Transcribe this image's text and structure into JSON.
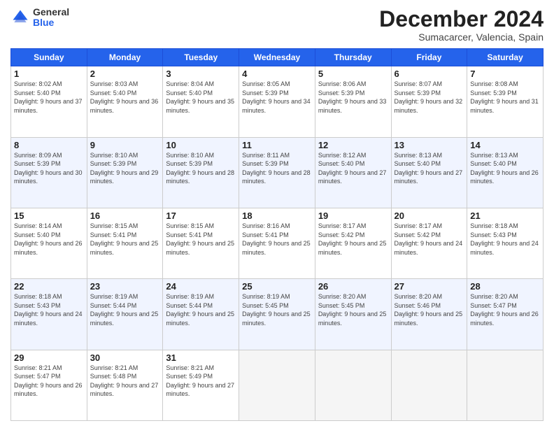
{
  "header": {
    "logo_general": "General",
    "logo_blue": "Blue",
    "month_title": "December 2024",
    "location": "Sumacarcer, Valencia, Spain"
  },
  "calendar": {
    "days_of_week": [
      "Sunday",
      "Monday",
      "Tuesday",
      "Wednesday",
      "Thursday",
      "Friday",
      "Saturday"
    ],
    "weeks": [
      [
        {
          "day": "",
          "info": ""
        },
        {
          "day": "",
          "info": ""
        },
        {
          "day": "",
          "info": ""
        },
        {
          "day": "",
          "info": ""
        },
        {
          "day": "",
          "info": ""
        },
        {
          "day": "",
          "info": ""
        },
        {
          "day": "",
          "info": ""
        }
      ]
    ],
    "cells": [
      {
        "day": "1",
        "sunrise": "8:02 AM",
        "sunset": "5:40 PM",
        "daylight": "9 hours and 37 minutes."
      },
      {
        "day": "2",
        "sunrise": "8:03 AM",
        "sunset": "5:40 PM",
        "daylight": "9 hours and 36 minutes."
      },
      {
        "day": "3",
        "sunrise": "8:04 AM",
        "sunset": "5:40 PM",
        "daylight": "9 hours and 35 minutes."
      },
      {
        "day": "4",
        "sunrise": "8:05 AM",
        "sunset": "5:39 PM",
        "daylight": "9 hours and 34 minutes."
      },
      {
        "day": "5",
        "sunrise": "8:06 AM",
        "sunset": "5:39 PM",
        "daylight": "9 hours and 33 minutes."
      },
      {
        "day": "6",
        "sunrise": "8:07 AM",
        "sunset": "5:39 PM",
        "daylight": "9 hours and 32 minutes."
      },
      {
        "day": "7",
        "sunrise": "8:08 AM",
        "sunset": "5:39 PM",
        "daylight": "9 hours and 31 minutes."
      },
      {
        "day": "8",
        "sunrise": "8:09 AM",
        "sunset": "5:39 PM",
        "daylight": "9 hours and 30 minutes."
      },
      {
        "day": "9",
        "sunrise": "8:10 AM",
        "sunset": "5:39 PM",
        "daylight": "9 hours and 29 minutes."
      },
      {
        "day": "10",
        "sunrise": "8:10 AM",
        "sunset": "5:39 PM",
        "daylight": "9 hours and 28 minutes."
      },
      {
        "day": "11",
        "sunrise": "8:11 AM",
        "sunset": "5:39 PM",
        "daylight": "9 hours and 28 minutes."
      },
      {
        "day": "12",
        "sunrise": "8:12 AM",
        "sunset": "5:40 PM",
        "daylight": "9 hours and 27 minutes."
      },
      {
        "day": "13",
        "sunrise": "8:13 AM",
        "sunset": "5:40 PM",
        "daylight": "9 hours and 27 minutes."
      },
      {
        "day": "14",
        "sunrise": "8:13 AM",
        "sunset": "5:40 PM",
        "daylight": "9 hours and 26 minutes."
      },
      {
        "day": "15",
        "sunrise": "8:14 AM",
        "sunset": "5:40 PM",
        "daylight": "9 hours and 26 minutes."
      },
      {
        "day": "16",
        "sunrise": "8:15 AM",
        "sunset": "5:41 PM",
        "daylight": "9 hours and 25 minutes."
      },
      {
        "day": "17",
        "sunrise": "8:15 AM",
        "sunset": "5:41 PM",
        "daylight": "9 hours and 25 minutes."
      },
      {
        "day": "18",
        "sunrise": "8:16 AM",
        "sunset": "5:41 PM",
        "daylight": "9 hours and 25 minutes."
      },
      {
        "day": "19",
        "sunrise": "8:17 AM",
        "sunset": "5:42 PM",
        "daylight": "9 hours and 25 minutes."
      },
      {
        "day": "20",
        "sunrise": "8:17 AM",
        "sunset": "5:42 PM",
        "daylight": "9 hours and 24 minutes."
      },
      {
        "day": "21",
        "sunrise": "8:18 AM",
        "sunset": "5:43 PM",
        "daylight": "9 hours and 24 minutes."
      },
      {
        "day": "22",
        "sunrise": "8:18 AM",
        "sunset": "5:43 PM",
        "daylight": "9 hours and 24 minutes."
      },
      {
        "day": "23",
        "sunrise": "8:19 AM",
        "sunset": "5:44 PM",
        "daylight": "9 hours and 25 minutes."
      },
      {
        "day": "24",
        "sunrise": "8:19 AM",
        "sunset": "5:44 PM",
        "daylight": "9 hours and 25 minutes."
      },
      {
        "day": "25",
        "sunrise": "8:19 AM",
        "sunset": "5:45 PM",
        "daylight": "9 hours and 25 minutes."
      },
      {
        "day": "26",
        "sunrise": "8:20 AM",
        "sunset": "5:45 PM",
        "daylight": "9 hours and 25 minutes."
      },
      {
        "day": "27",
        "sunrise": "8:20 AM",
        "sunset": "5:46 PM",
        "daylight": "9 hours and 25 minutes."
      },
      {
        "day": "28",
        "sunrise": "8:20 AM",
        "sunset": "5:47 PM",
        "daylight": "9 hours and 26 minutes."
      },
      {
        "day": "29",
        "sunrise": "8:21 AM",
        "sunset": "5:47 PM",
        "daylight": "9 hours and 26 minutes."
      },
      {
        "day": "30",
        "sunrise": "8:21 AM",
        "sunset": "5:48 PM",
        "daylight": "9 hours and 27 minutes."
      },
      {
        "day": "31",
        "sunrise": "8:21 AM",
        "sunset": "5:49 PM",
        "daylight": "9 hours and 27 minutes."
      }
    ]
  }
}
